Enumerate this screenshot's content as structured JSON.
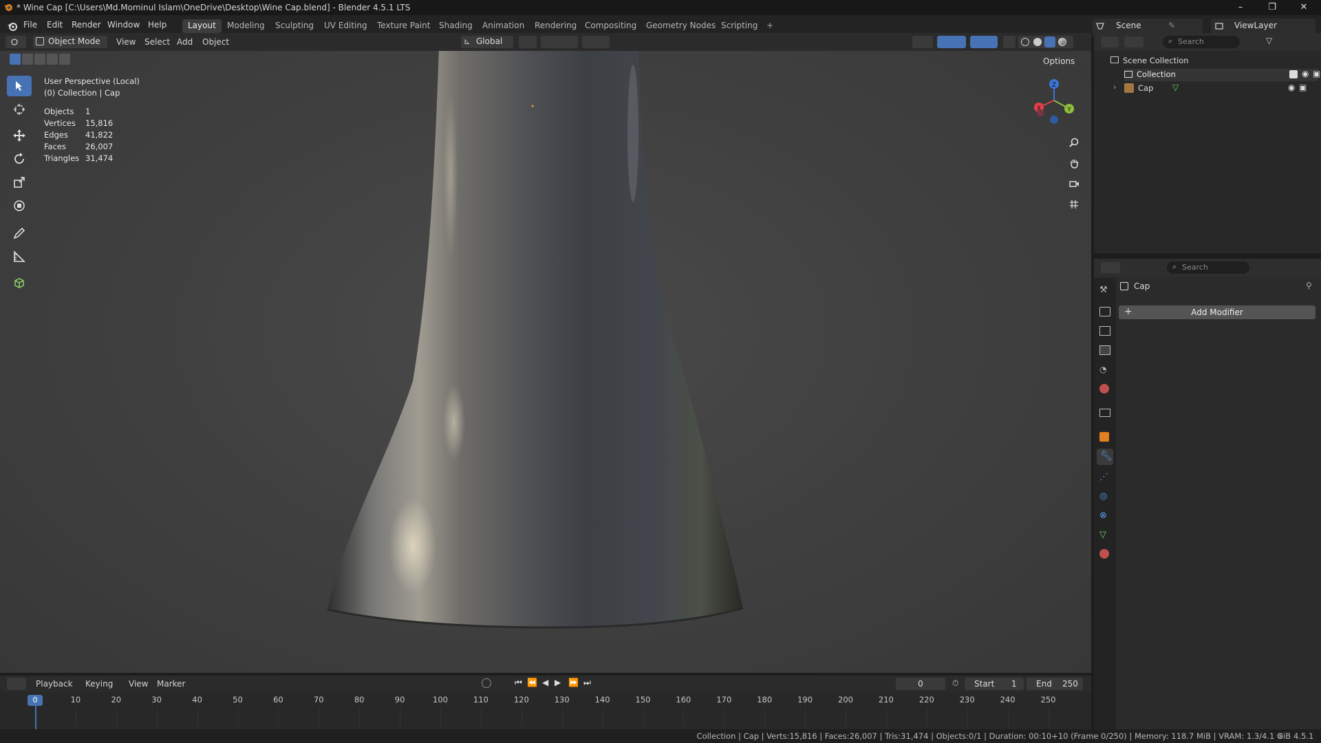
{
  "titlebar": {
    "title": "* Wine Cap [C:\\Users\\Md.Mominul Islam\\OneDrive\\Desktop\\Wine Cap.blend] - Blender 4.5.1 LTS",
    "minimize": "–",
    "maximize": "❐",
    "close": "✕"
  },
  "menu": {
    "items": [
      "File",
      "Edit",
      "Render",
      "Window",
      "Help"
    ]
  },
  "workspaces": {
    "tabs": [
      "Layout",
      "Modeling",
      "Sculpting",
      "UV Editing",
      "Texture Paint",
      "Shading",
      "Animation",
      "Rendering",
      "Compositing",
      "Geometry Nodes",
      "Scripting"
    ],
    "active": "Layout",
    "add": "+"
  },
  "scene": {
    "name": "Scene",
    "view_layer": "ViewLayer"
  },
  "viewport_header": {
    "mode": "Object Mode",
    "menus": [
      "View",
      "Select",
      "Add",
      "Object"
    ],
    "orientation": "Global",
    "options": "Options"
  },
  "viewport": {
    "view_name": "User Perspective (Local)",
    "collection_info": "(0) Collection | Cap",
    "stats": [
      {
        "label": "Objects",
        "value": "1"
      },
      {
        "label": "Vertices",
        "value": "15,816"
      },
      {
        "label": "Edges",
        "value": "41,822"
      },
      {
        "label": "Faces",
        "value": "26,007"
      },
      {
        "label": "Triangles",
        "value": "31,474"
      }
    ],
    "gizmo": {
      "x": "X",
      "y": "Y",
      "z": "Z"
    }
  },
  "outliner": {
    "search_placeholder": "Search",
    "root": "Scene Collection",
    "collection": "Collection",
    "object": "Cap"
  },
  "properties": {
    "search_placeholder": "Search",
    "object_name": "Cap",
    "add_modifier": "Add Modifier"
  },
  "timeline": {
    "menus": [
      "Playback",
      "Keying",
      "View",
      "Marker"
    ],
    "current_frame": "0",
    "start_label": "Start",
    "start": "1",
    "end_label": "End",
    "end": "250",
    "ticks": [
      "0",
      "10",
      "20",
      "30",
      "40",
      "50",
      "60",
      "70",
      "80",
      "90",
      "100",
      "110",
      "120",
      "130",
      "140",
      "150",
      "160",
      "170",
      "180",
      "190",
      "200",
      "210",
      "220",
      "230",
      "240",
      "250"
    ],
    "playhead_frame": "0"
  },
  "statusbar": {
    "text": "Collection | Cap | Verts:15,816 | Faces:26,007 | Tris:31,474 | Objects:0/1 | Duration: 00:10+10 (Frame 0/250) | Memory: 118.7 MiB | VRAM: 1.3/4.1 GiB",
    "version": "4.5.1"
  }
}
